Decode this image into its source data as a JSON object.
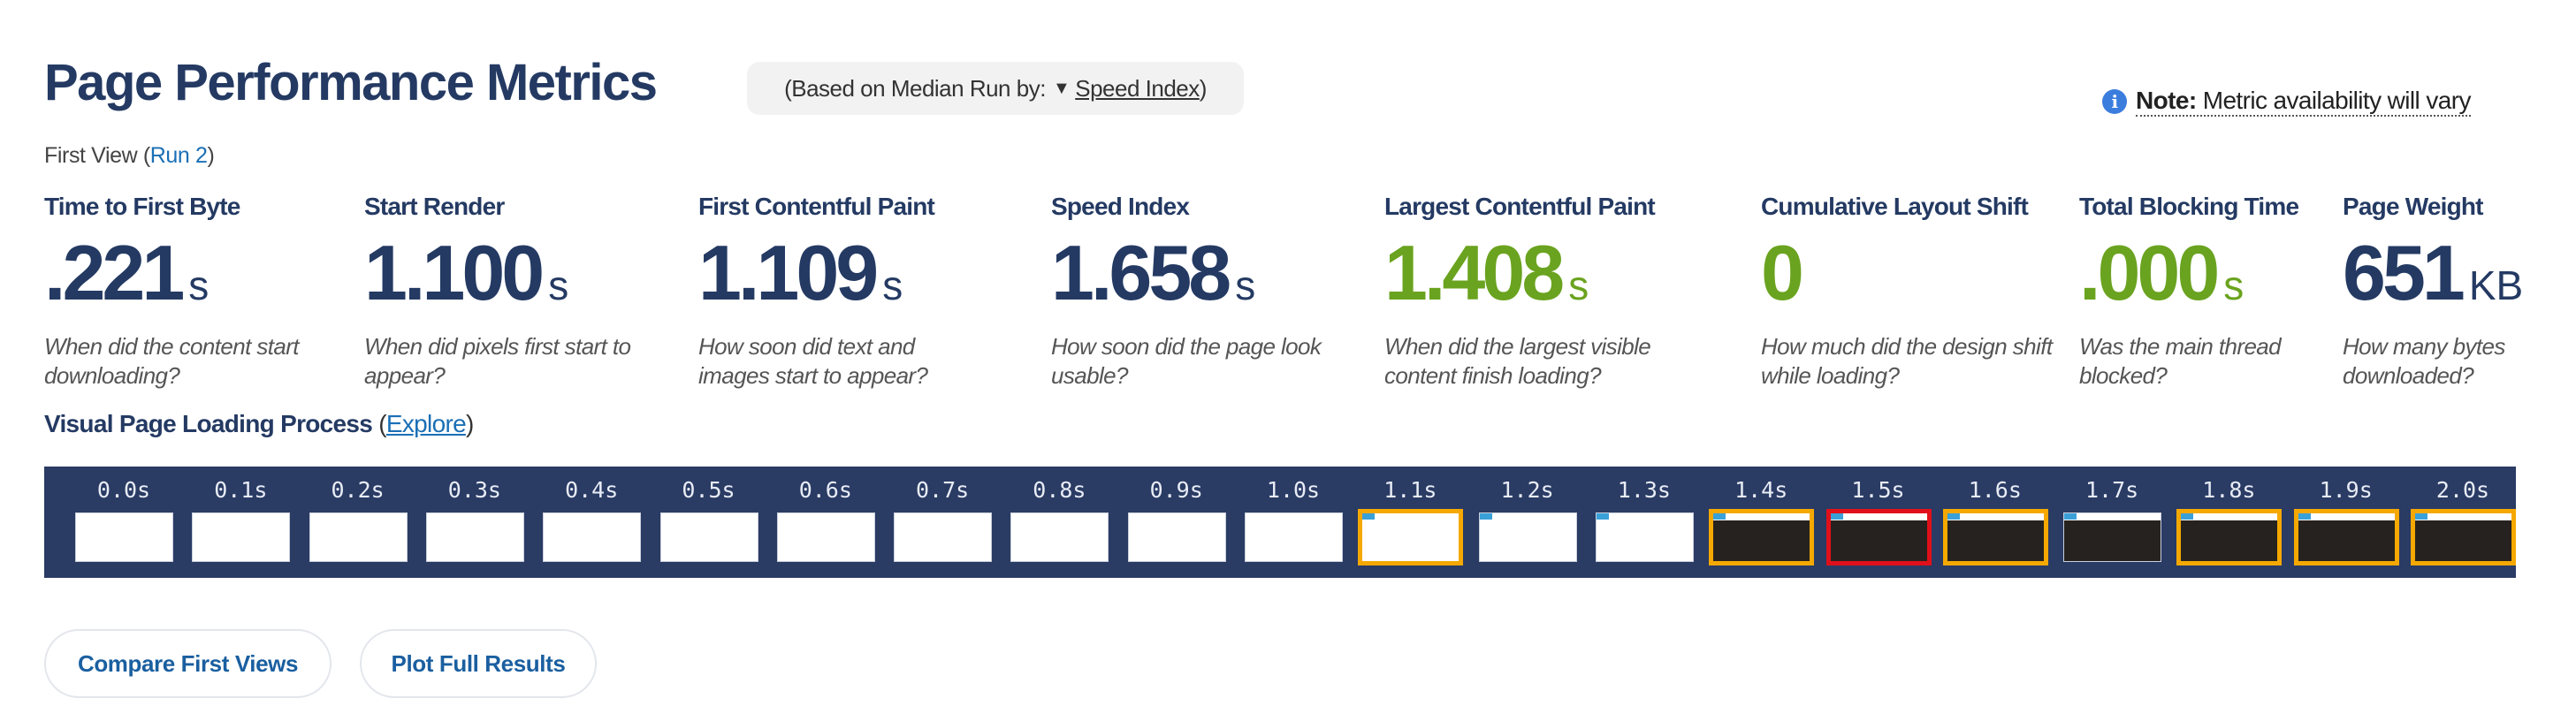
{
  "header": {
    "title": "Page Performance Metrics",
    "median_prefix": "(Based on Median Run by:",
    "median_arrow": "▼",
    "median_metric": "Speed Index",
    "median_suffix": ")",
    "note_label": "Note:",
    "note_text": "Metric availability will vary",
    "info_icon": "i"
  },
  "view": {
    "label": "First View (",
    "run": "Run 2",
    "close": ")"
  },
  "metrics": [
    {
      "label": "Time to First Byte",
      "value": ".221",
      "unit": "s",
      "desc": "When did the content start downloading?",
      "color": "#243a63"
    },
    {
      "label": "Start Render",
      "value": "1.100",
      "unit": "s",
      "desc": "When did pixels first start to appear?",
      "color": "#243a63"
    },
    {
      "label": "First Contentful Paint",
      "value": "1.109",
      "unit": "s",
      "desc": "How soon did text and images start to appear?",
      "color": "#243a63"
    },
    {
      "label": "Speed Index",
      "value": "1.658",
      "unit": "s",
      "desc": "How soon did the page look usable?",
      "color": "#243a63"
    },
    {
      "label": "Largest Contentful Paint",
      "value": "1.408",
      "unit": "s",
      "desc": "When did the largest visible content finish loading?",
      "color": "#6aa31f"
    },
    {
      "label": "Cumulative Layout Shift",
      "value": "0",
      "unit": "",
      "desc": "How much did the design shift while loading?",
      "color": "#6aa31f"
    },
    {
      "label": "Total Blocking Time",
      "value": ".000",
      "unit": "s",
      "desc": "Was the main thread blocked?",
      "color": "#6aa31f"
    },
    {
      "label": "Page Weight",
      "value": "651",
      "unit": "KB",
      "desc": "How many bytes downloaded?",
      "color": "#243a63"
    }
  ],
  "visual": {
    "title": "Visual Page Loading Process",
    "open": " (",
    "explore": "Explore",
    "close": ")"
  },
  "filmstrip": [
    {
      "time": "0.0s",
      "state": "blank",
      "highlight": "none"
    },
    {
      "time": "0.1s",
      "state": "blank",
      "highlight": "none"
    },
    {
      "time": "0.2s",
      "state": "blank",
      "highlight": "none"
    },
    {
      "time": "0.3s",
      "state": "blank",
      "highlight": "none"
    },
    {
      "time": "0.4s",
      "state": "blank",
      "highlight": "none"
    },
    {
      "time": "0.5s",
      "state": "blank",
      "highlight": "none"
    },
    {
      "time": "0.6s",
      "state": "blank",
      "highlight": "none"
    },
    {
      "time": "0.7s",
      "state": "blank",
      "highlight": "none"
    },
    {
      "time": "0.8s",
      "state": "blank",
      "highlight": "none"
    },
    {
      "time": "0.9s",
      "state": "blank",
      "highlight": "none"
    },
    {
      "time": "1.0s",
      "state": "blank",
      "highlight": "none"
    },
    {
      "time": "1.1s",
      "state": "partial",
      "highlight": "changed"
    },
    {
      "time": "1.2s",
      "state": "partial",
      "highlight": "none"
    },
    {
      "time": "1.3s",
      "state": "partial",
      "highlight": "none"
    },
    {
      "time": "1.4s",
      "state": "dark",
      "highlight": "changed"
    },
    {
      "time": "1.5s",
      "state": "dark",
      "highlight": "lcp"
    },
    {
      "time": "1.6s",
      "state": "dark",
      "highlight": "changed"
    },
    {
      "time": "1.7s",
      "state": "dark",
      "highlight": "none"
    },
    {
      "time": "1.8s",
      "state": "dark",
      "highlight": "changed"
    },
    {
      "time": "1.9s",
      "state": "dark",
      "highlight": "changed"
    },
    {
      "time": "2.0s",
      "state": "dark",
      "highlight": "changed"
    }
  ],
  "colors": {
    "changed": "#f5a800",
    "lcp": "#e0101a",
    "strip_bg": "#2a3b64",
    "good": "#6aa31f"
  },
  "buttons": {
    "compare": "Compare First Views",
    "plot": "Plot Full Results"
  }
}
